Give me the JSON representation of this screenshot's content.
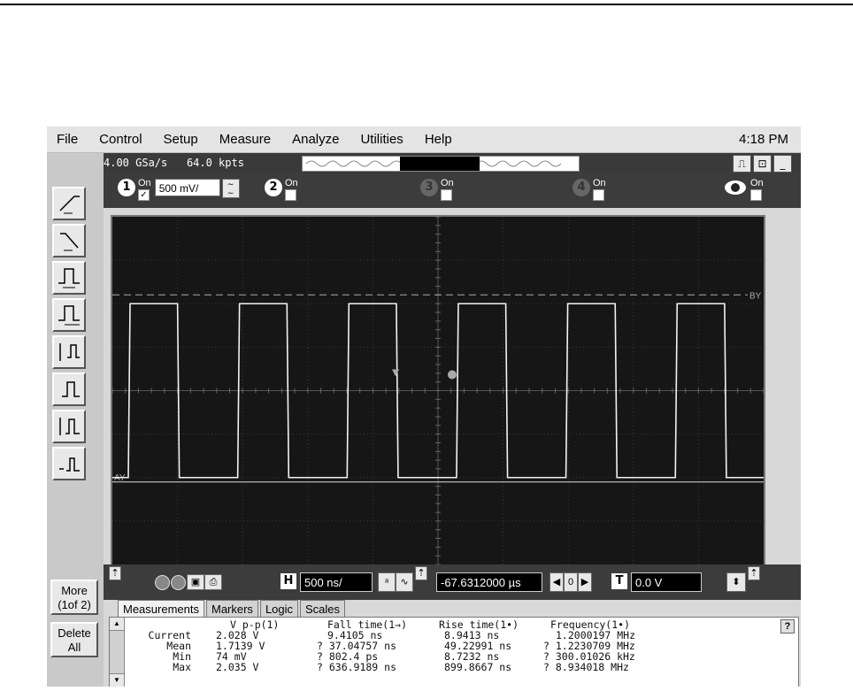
{
  "menu": {
    "items": [
      "File",
      "Control",
      "Setup",
      "Measure",
      "Analyze",
      "Utilities",
      "Help"
    ],
    "clock": "4:18 PM"
  },
  "info": {
    "sample_rate": "4.00 GSa/s",
    "memory": "64.0 kpts"
  },
  "channels": [
    {
      "num": "1",
      "on": "On",
      "checked": true,
      "vdiv": "500 mV/"
    },
    {
      "num": "2",
      "on": "On",
      "checked": false
    },
    {
      "num": "3",
      "on": "On",
      "checked": false
    },
    {
      "num": "4",
      "on": "On",
      "checked": false
    },
    {
      "num": "",
      "on": "On",
      "checked": false
    }
  ],
  "markers": {
    "top": "BY",
    "bottom": "AY"
  },
  "left_buttons": {
    "more": "More\n(1of 2)",
    "delete": "Delete\nAll"
  },
  "horizontal": {
    "h_label": "H",
    "time_div": "500 ns/",
    "delay": "-67.6312000 µs",
    "t_label": "T",
    "trigger_level": "0.0 V",
    "delay_ctrl": "0"
  },
  "tabs": [
    "Measurements",
    "Markers",
    "Logic",
    "Scales"
  ],
  "measurements": {
    "headers": [
      "V p-p(1)",
      "Fall time(1→)",
      "Rise time(1•)",
      "Frequency(1•)"
    ],
    "row_labels": [
      "Current",
      "Mean",
      "Min",
      "Max"
    ],
    "vpp": [
      "2.028 V",
      "1.7139 V",
      "74 mV",
      "2.035 V"
    ],
    "fall": [
      "9.4105 ns",
      "? 37.04757 ns",
      "? 802.4 ps",
      "? 636.9189 ns"
    ],
    "rise": [
      "8.9413 ns",
      "49.22991 ns",
      "8.7232 ns",
      "899.8667 ns"
    ],
    "freq": [
      "1.2000197 MHz",
      "? 1.2230709 MHz",
      "? 300.01026 kHz",
      "? 8.934018 MHz"
    ]
  },
  "chart_data": {
    "type": "line",
    "description_period_div": 2.0,
    "high_level_div": 2.0,
    "low_level_div": -2.0
  }
}
